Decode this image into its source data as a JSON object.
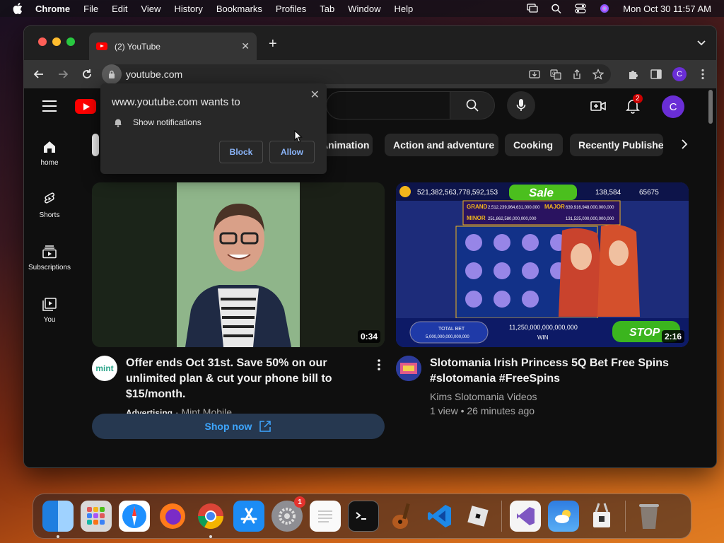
{
  "menubar": {
    "app_name": "Chrome",
    "items": [
      "File",
      "Edit",
      "View",
      "History",
      "Bookmarks",
      "Profiles",
      "Tab",
      "Window",
      "Help"
    ],
    "clock": "Mon Oct 30  11:57 AM"
  },
  "browser": {
    "tab_title": "(2) YouTube",
    "tab_close": "✕",
    "new_tab": "+",
    "url": "youtube.com",
    "profile_initial": "C"
  },
  "youtube": {
    "notification_count": "2",
    "avatar_initial": "C",
    "chips": [
      "Animation",
      "Action and adventure",
      "Cooking",
      "Recently Publishe"
    ],
    "sidebar": [
      {
        "label": "home",
        "icon": "home-icon"
      },
      {
        "label": "Shorts",
        "icon": "shorts-icon"
      },
      {
        "label": "Subscriptions",
        "icon": "subscriptions-icon"
      },
      {
        "label": "You",
        "icon": "you-icon"
      }
    ],
    "videos": [
      {
        "title": "Offer ends Oct 31st. Save 50% on our unlimited plan & cut your phone bill to $15/month.",
        "duration": "0:34",
        "ad_label": "Advertising",
        "channel": "Mint Mobile",
        "channel_avatar_text": "mint",
        "cta": "Shop now"
      },
      {
        "title": "Slotomania Irish Princess 5Q Bet Free Spins #slotomania #FreeSpins",
        "duration": "2:16",
        "channel": "Kims Slotomania Videos",
        "stats": "1 view • 26 minutes ago",
        "thumb": {
          "coins": "521,382,563,778,592,153",
          "sale": "Sale",
          "gems": "138,584",
          "stars": "65675",
          "grand_label": "GRAND",
          "grand": "2,512,239,964,631,000,000",
          "major_label": "MAJOR",
          "major": "639,916,948,000,000,000",
          "minor_label": "MINOR",
          "minor": "251,862,580,000,000,000",
          "mini": "131,525,000,000,000,000",
          "total_bet_label": "TOTAL BET",
          "total_bet": "5,000,000,000,000,000",
          "win": "11,250,000,000,000,000",
          "win_label": "WIN",
          "stop": "STOP"
        }
      }
    ]
  },
  "popup": {
    "title": "www.youtube.com wants to",
    "permission": "Show notifications",
    "block": "Block",
    "allow": "Allow",
    "close": "✕"
  },
  "dock": {
    "settings_badge": "1",
    "items": [
      "finder-icon",
      "launchpad-icon",
      "safari-icon",
      "firefox-icon",
      "chrome-icon",
      "app-store-icon",
      "system-settings-icon",
      "textedit-icon",
      "terminal-icon",
      "garageband-icon",
      "vscode-icon",
      "roblox-icon",
      "visual-studio-icon",
      "weather-icon",
      "archive-utility-icon",
      "trash-icon"
    ]
  },
  "colors": {
    "yt_red": "#ff0000",
    "link_blue": "#3ea6ff",
    "popup_button": "#8ab4f8",
    "profile_purple": "#6a2ed6"
  }
}
